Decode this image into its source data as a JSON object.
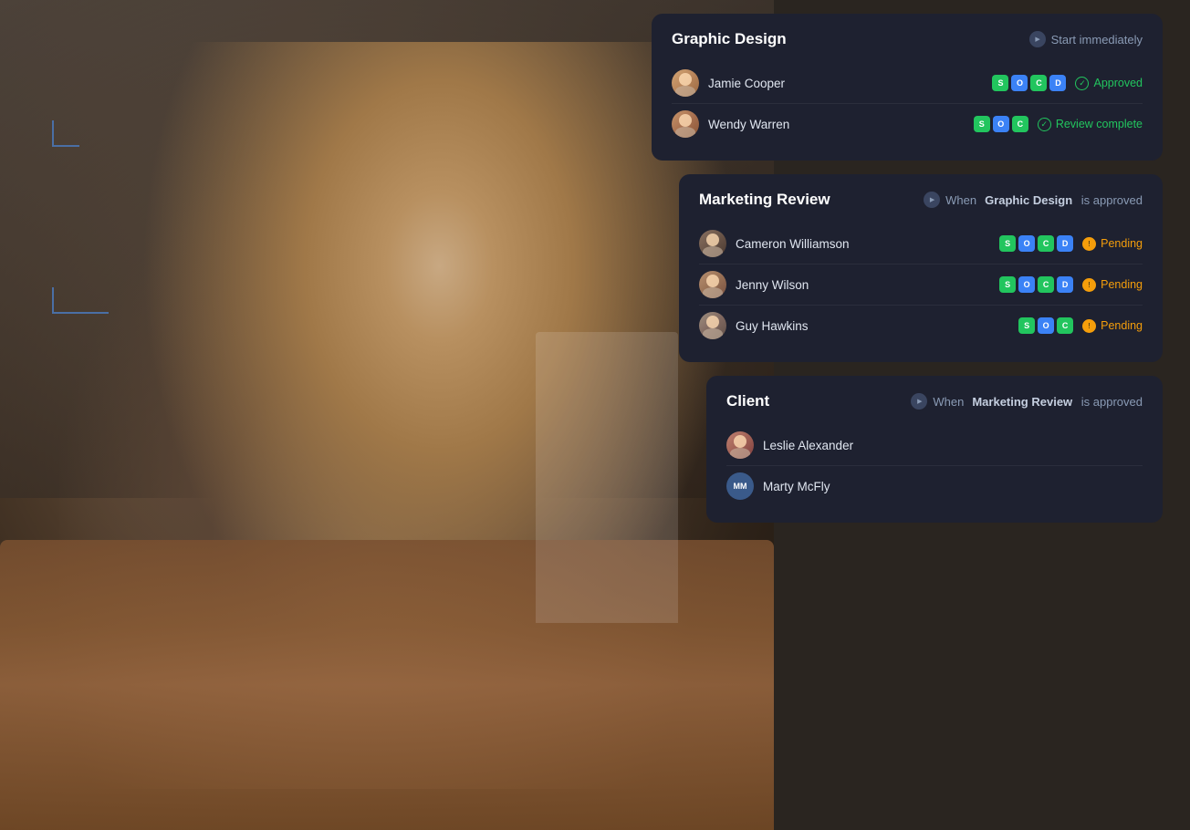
{
  "background": {
    "description": "Woman smiling with tablet at wooden table, industrial concrete wall background"
  },
  "cards": {
    "graphic_design": {
      "title": "Graphic Design",
      "trigger_text": "Start immediately",
      "trigger_icon": "play-icon",
      "people": [
        {
          "name": "Jamie Cooper",
          "avatar_class": "avatar-jamie",
          "tags": [
            "S",
            "O",
            "C",
            "D"
          ],
          "status": "Approved",
          "status_type": "approved"
        },
        {
          "name": "Wendy Warren",
          "avatar_class": "avatar-wendy",
          "tags": [
            "S",
            "O",
            "C"
          ],
          "status": "Review complete",
          "status_type": "review"
        }
      ]
    },
    "marketing_review": {
      "title": "Marketing Review",
      "trigger_prefix": "When",
      "trigger_bold": "Graphic Design",
      "trigger_suffix": "is approved",
      "trigger_icon": "play-icon",
      "people": [
        {
          "name": "Cameron Williamson",
          "avatar_class": "avatar-cameron",
          "tags": [
            "S",
            "O",
            "C",
            "D"
          ],
          "status": "Pending",
          "status_type": "pending"
        },
        {
          "name": "Jenny Wilson",
          "avatar_class": "avatar-jenny",
          "tags": [
            "S",
            "O",
            "C",
            "D"
          ],
          "status": "Pending",
          "status_type": "pending"
        },
        {
          "name": "Guy Hawkins",
          "avatar_class": "avatar-guy",
          "tags": [
            "S",
            "O",
            "C"
          ],
          "status": "Pending",
          "status_type": "pending"
        }
      ]
    },
    "client": {
      "title": "Client",
      "trigger_prefix": "When",
      "trigger_bold": "Marketing Review",
      "trigger_suffix": "is approved",
      "trigger_icon": "play-icon",
      "people": [
        {
          "name": "Leslie Alexander",
          "avatar_class": "avatar-leslie",
          "tags": [],
          "status": "",
          "status_type": ""
        },
        {
          "name": "Marty McFly",
          "avatar_class": "avatar-mm",
          "avatar_initials": "MM",
          "tags": [],
          "status": "",
          "status_type": ""
        }
      ]
    }
  },
  "labels": {
    "start_immediately": "Start immediately",
    "when": "When",
    "is_approved": "is approved",
    "approved": "Approved",
    "review_complete": "Review complete",
    "pending": "Pending",
    "graphic_design": "Graphic Design",
    "marketing_review": "Marketing Review",
    "client": "Client"
  },
  "tag_labels": {
    "s": "S",
    "o": "O",
    "c": "C",
    "d": "D"
  }
}
